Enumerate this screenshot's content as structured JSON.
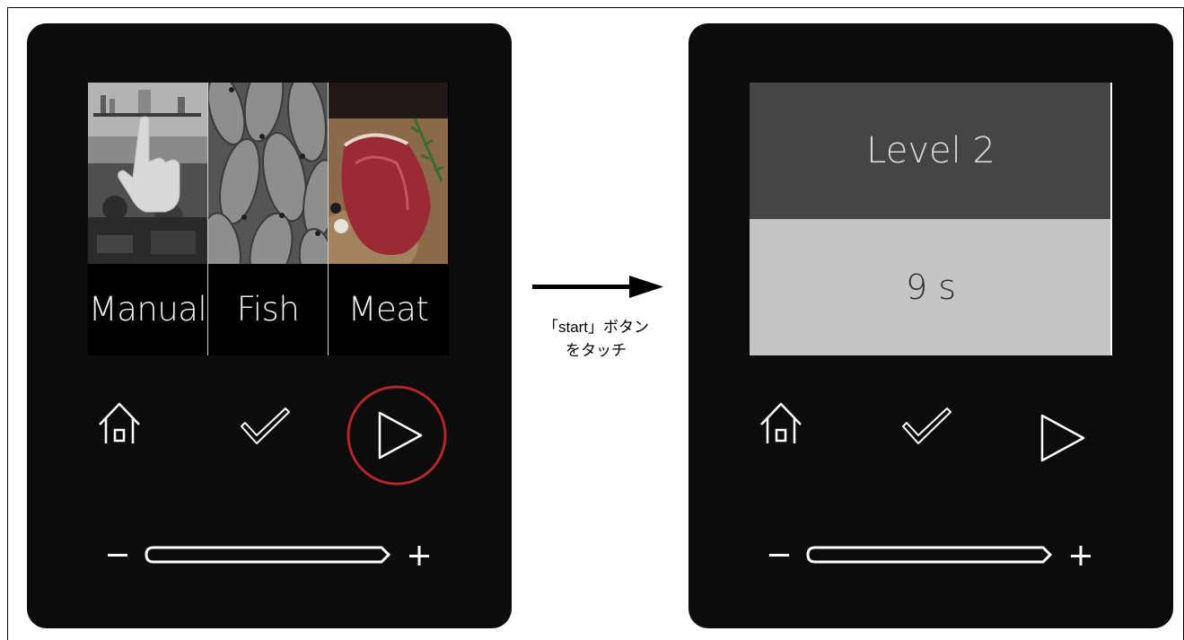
{
  "left_panel": {
    "menu_items": [
      {
        "label": "Manual",
        "photo": "hand-kitchen-photo"
      },
      {
        "label": "Fish",
        "photo": "fish-photo"
      },
      {
        "label": "Meat",
        "photo": "steak-photo"
      }
    ],
    "selected_control": "start"
  },
  "right_panel": {
    "level_label": "Level 2",
    "timer_label": "9 s"
  },
  "controls": {
    "home": "home-icon",
    "confirm": "check-icon",
    "start": "play-icon",
    "minus": "minus-icon",
    "plus": "plus-icon"
  },
  "transition": {
    "caption_line1": "「start」ボタン",
    "caption_line2": "をタッチ"
  },
  "colors": {
    "device": "#0c0c0c",
    "highlight_ring": "#b3262b",
    "level_bg": "#454545",
    "timer_bg": "#c4c4c4"
  }
}
